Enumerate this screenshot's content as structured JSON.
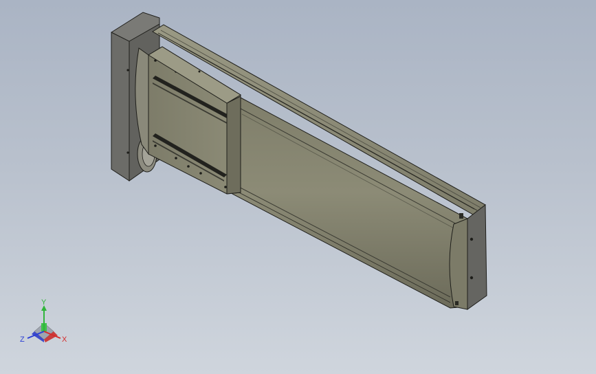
{
  "scene": {
    "subject": "linear-actuator-module",
    "colors": {
      "background_top": "#aab4c4",
      "background_bottom": "#cfd5dd",
      "body_light": "#8c8b76",
      "body_mid": "#7b7a66",
      "body_dark": "#5e5d4d",
      "end_block": "#6c6c68",
      "end_block_face": "#7a7a76",
      "outline": "#1e1e1a",
      "slot": "#22221e"
    }
  },
  "triad": {
    "x_label": "X",
    "y_label": "Y",
    "z_label": "Z",
    "colors": {
      "x": "#d52b2b",
      "y": "#2fb53a",
      "z": "#2b3fd5"
    }
  }
}
